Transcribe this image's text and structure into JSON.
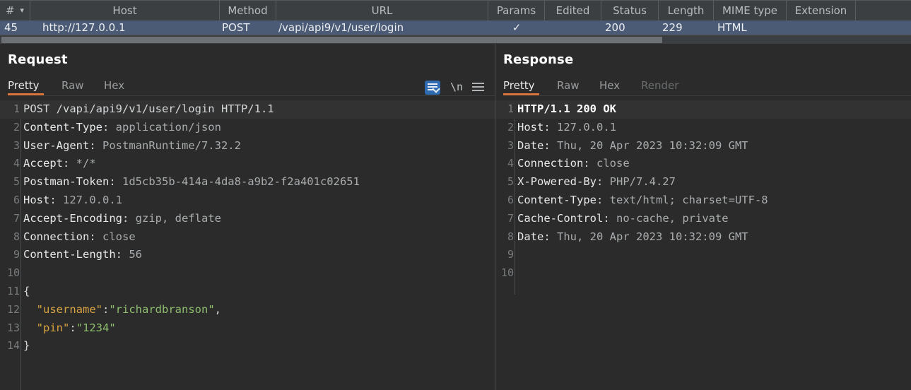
{
  "history_table": {
    "columns": [
      {
        "label": "#",
        "sort_icon": "chevron-down-icon"
      },
      {
        "label": "Host"
      },
      {
        "label": "Method"
      },
      {
        "label": "URL"
      },
      {
        "label": "Params"
      },
      {
        "label": "Edited"
      },
      {
        "label": "Status"
      },
      {
        "label": "Length"
      },
      {
        "label": "MIME type"
      },
      {
        "label": "Extension"
      },
      {
        "label": ""
      }
    ],
    "selected_row": {
      "number": "45",
      "host": "http://127.0.0.1",
      "method": "POST",
      "url": "/vapi/api9/v1/user/login",
      "params": "✓",
      "edited": "",
      "status": "200",
      "length": "229",
      "mime_type": "HTML",
      "extension": "",
      "row_color": "#4b5a75"
    }
  },
  "request": {
    "title": "Request",
    "tabs": [
      {
        "label": "Pretty",
        "active": true
      },
      {
        "label": "Raw",
        "active": false
      },
      {
        "label": "Hex",
        "active": false
      }
    ],
    "toolbar": {
      "word_wrap_icon": "word-wrap-icon",
      "word_wrap_active": true,
      "newline_label": "\\n",
      "menu_icon": "hamburger-menu-icon"
    },
    "lines": [
      {
        "n": "1",
        "highlight": true,
        "segments": [
          {
            "t": "POST /vapi/api9/v1/user/login HTTP/1.1",
            "c": "plain"
          }
        ]
      },
      {
        "n": "2",
        "highlight": false,
        "segments": [
          {
            "t": "Content-Type",
            "c": "hdr-name"
          },
          {
            "t": ": ",
            "c": "punc"
          },
          {
            "t": "application/json",
            "c": "hdr-val"
          }
        ]
      },
      {
        "n": "3",
        "highlight": false,
        "segments": [
          {
            "t": "User-Agent",
            "c": "hdr-name"
          },
          {
            "t": ": ",
            "c": "punc"
          },
          {
            "t": "PostmanRuntime/7.32.2",
            "c": "hdr-val"
          }
        ]
      },
      {
        "n": "4",
        "highlight": false,
        "segments": [
          {
            "t": "Accept",
            "c": "hdr-name"
          },
          {
            "t": ": ",
            "c": "punc"
          },
          {
            "t": "*/*",
            "c": "hdr-val"
          }
        ]
      },
      {
        "n": "5",
        "highlight": false,
        "segments": [
          {
            "t": "Postman-Token",
            "c": "hdr-name"
          },
          {
            "t": ": ",
            "c": "punc"
          },
          {
            "t": "1d5cb35b-414a-4da8-a9b2-f2a401c02651",
            "c": "hdr-val"
          }
        ]
      },
      {
        "n": "6",
        "highlight": false,
        "segments": [
          {
            "t": "Host",
            "c": "hdr-name"
          },
          {
            "t": ": ",
            "c": "punc"
          },
          {
            "t": "127.0.0.1",
            "c": "hdr-val"
          }
        ]
      },
      {
        "n": "7",
        "highlight": false,
        "segments": [
          {
            "t": "Accept-Encoding",
            "c": "hdr-name"
          },
          {
            "t": ": ",
            "c": "punc"
          },
          {
            "t": "gzip, deflate",
            "c": "hdr-val"
          }
        ]
      },
      {
        "n": "8",
        "highlight": false,
        "segments": [
          {
            "t": "Connection",
            "c": "hdr-name"
          },
          {
            "t": ": ",
            "c": "punc"
          },
          {
            "t": "close",
            "c": "hdr-val"
          }
        ]
      },
      {
        "n": "9",
        "highlight": false,
        "segments": [
          {
            "t": "Content-Length",
            "c": "hdr-name"
          },
          {
            "t": ": ",
            "c": "punc"
          },
          {
            "t": "56",
            "c": "hdr-val"
          }
        ]
      },
      {
        "n": "10",
        "highlight": false,
        "segments": []
      },
      {
        "n": "11",
        "highlight": false,
        "segments": [
          {
            "t": "{",
            "c": "punc"
          }
        ]
      },
      {
        "n": "12",
        "highlight": false,
        "segments": [
          {
            "t": "  ",
            "c": "punc"
          },
          {
            "t": "\"username\"",
            "c": "json-key"
          },
          {
            "t": ":",
            "c": "punc"
          },
          {
            "t": "\"richardbranson\"",
            "c": "json-str"
          },
          {
            "t": ",",
            "c": "punc"
          }
        ]
      },
      {
        "n": "13",
        "highlight": false,
        "segments": [
          {
            "t": "  ",
            "c": "punc"
          },
          {
            "t": "\"pin\"",
            "c": "json-key"
          },
          {
            "t": ":",
            "c": "punc"
          },
          {
            "t": "\"1234\"",
            "c": "json-str"
          }
        ]
      },
      {
        "n": "14",
        "highlight": false,
        "segments": [
          {
            "t": "}",
            "c": "punc"
          }
        ]
      }
    ]
  },
  "response": {
    "title": "Response",
    "tabs": [
      {
        "label": "Pretty",
        "active": true,
        "disabled": false
      },
      {
        "label": "Raw",
        "active": false,
        "disabled": false
      },
      {
        "label": "Hex",
        "active": false,
        "disabled": false
      },
      {
        "label": "Render",
        "active": false,
        "disabled": true
      }
    ],
    "lines": [
      {
        "n": "1",
        "highlight": true,
        "segments": [
          {
            "t": "HTTP/1.1 200 OK",
            "c": "bold-w"
          }
        ]
      },
      {
        "n": "2",
        "highlight": false,
        "segments": [
          {
            "t": "Host",
            "c": "hdr-name"
          },
          {
            "t": ": ",
            "c": "punc"
          },
          {
            "t": "127.0.0.1",
            "c": "hdr-val"
          }
        ]
      },
      {
        "n": "3",
        "highlight": false,
        "segments": [
          {
            "t": "Date",
            "c": "hdr-name"
          },
          {
            "t": ": ",
            "c": "punc"
          },
          {
            "t": "Thu, 20 Apr 2023 10:32:09 GMT",
            "c": "hdr-val"
          }
        ]
      },
      {
        "n": "4",
        "highlight": false,
        "segments": [
          {
            "t": "Connection",
            "c": "hdr-name"
          },
          {
            "t": ": ",
            "c": "punc"
          },
          {
            "t": "close",
            "c": "hdr-val"
          }
        ]
      },
      {
        "n": "5",
        "highlight": false,
        "segments": [
          {
            "t": "X-Powered-By",
            "c": "hdr-name"
          },
          {
            "t": ": ",
            "c": "punc"
          },
          {
            "t": "PHP/7.4.27",
            "c": "hdr-val"
          }
        ]
      },
      {
        "n": "6",
        "highlight": false,
        "segments": [
          {
            "t": "Content-Type",
            "c": "hdr-name"
          },
          {
            "t": ": ",
            "c": "punc"
          },
          {
            "t": "text/html; charset=UTF-8",
            "c": "hdr-val"
          }
        ]
      },
      {
        "n": "7",
        "highlight": false,
        "segments": [
          {
            "t": "Cache-Control",
            "c": "hdr-name"
          },
          {
            "t": ": ",
            "c": "punc"
          },
          {
            "t": "no-cache, private",
            "c": "hdr-val"
          }
        ]
      },
      {
        "n": "8",
        "highlight": false,
        "segments": [
          {
            "t": "Date",
            "c": "hdr-name"
          },
          {
            "t": ": ",
            "c": "punc"
          },
          {
            "t": "Thu, 20 Apr 2023 10:32:09 GMT",
            "c": "hdr-val"
          }
        ]
      },
      {
        "n": "9",
        "highlight": false,
        "segments": []
      },
      {
        "n": "10",
        "highlight": false,
        "segments": []
      }
    ]
  },
  "colors": {
    "accent_orange": "#d9743a",
    "selection_blue": "#4b5a75",
    "toolbar_blue": "#2f6bb0",
    "json_key": "#d9a441",
    "json_string": "#8fbf6f",
    "background": "#2b2b2b",
    "header_background": "#3c3f41"
  }
}
